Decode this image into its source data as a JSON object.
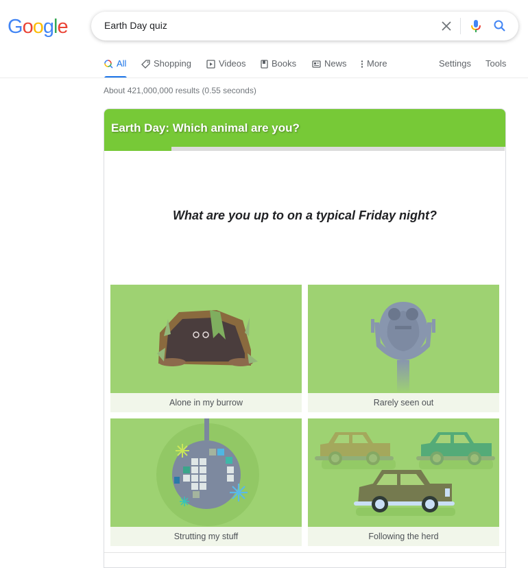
{
  "logo": {
    "letters": [
      {
        "char": "G",
        "color": "#4285f4"
      },
      {
        "char": "o",
        "color": "#ea4335"
      },
      {
        "char": "o",
        "color": "#fbbc05"
      },
      {
        "char": "g",
        "color": "#4285f4"
      },
      {
        "char": "l",
        "color": "#34a853"
      },
      {
        "char": "e",
        "color": "#ea4335"
      }
    ]
  },
  "search": {
    "value": "Earth Day quiz",
    "clear_icon": "close-icon",
    "mic_icon": "microphone-icon",
    "search_icon": "search-icon"
  },
  "tabs": [
    {
      "label": "All",
      "icon": "search-icon",
      "active": true
    },
    {
      "label": "Shopping",
      "icon": "tag-icon"
    },
    {
      "label": "Videos",
      "icon": "play-icon"
    },
    {
      "label": "Books",
      "icon": "book-icon"
    },
    {
      "label": "News",
      "icon": "newspaper-icon"
    },
    {
      "label": "More",
      "icon": "more-vert-icon"
    }
  ],
  "tools": {
    "settings_label": "Settings",
    "tools_label": "Tools"
  },
  "result_stats": "About 421,000,000 results (0.55 seconds)",
  "quiz": {
    "title": "Earth Day: Which animal are you?",
    "progress_fraction": 0.167,
    "accent_color": "#77c937",
    "question": "What are you up to on a typical Friday night?",
    "answers": [
      {
        "label": "Alone in my burrow",
        "image": "burrow-illustration"
      },
      {
        "label": "Rarely seen out",
        "image": "binocular-viewer-illustration"
      },
      {
        "label": "Strutting my stuff",
        "image": "disco-ball-illustration"
      },
      {
        "label": "Following the herd",
        "image": "cars-illustration"
      }
    ]
  }
}
